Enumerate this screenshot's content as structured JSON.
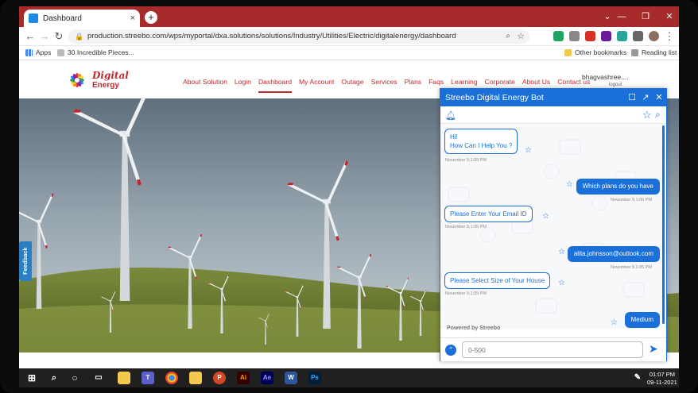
{
  "browser": {
    "tab_title": "Dashboard",
    "tab_close": "×",
    "new_tab": "+",
    "url": "production.streebo.com/wps/myportal/dxa.solutions/solutions/Industry/Utilities/Electric/digitalenergy/dashboard",
    "back": "←",
    "forward": "→",
    "reload": "↻",
    "min": "—",
    "max": "❐",
    "close": "✕",
    "bookmarks": {
      "apps": "Apps",
      "item1": "30 Incredible Pieces...",
      "other": "Other bookmarks",
      "reading": "Reading list"
    }
  },
  "site": {
    "logo_line1": "Digital",
    "logo_line2": "Energy",
    "nav": [
      "About Solution",
      "Login",
      "Dashboard",
      "My Account",
      "Outage",
      "Services",
      "Plans",
      "Faqs",
      "Learning",
      "Corporate",
      "About Us",
      "Contact us"
    ],
    "active_nav": "Dashboard",
    "user": "bhagvashree....",
    "user_sub": "logout",
    "feedback": "Feedback"
  },
  "bot": {
    "title": "Streebo Digital Energy Bot",
    "messages": [
      {
        "from": "bot",
        "lines": [
          "Hi!",
          "How Can I Help You ?"
        ],
        "time": "November 9,1:05 PM"
      },
      {
        "from": "user",
        "text": "Which plans do you have",
        "time": "November 9,1:05 PM"
      },
      {
        "from": "bot",
        "lines": [
          "Please Enter Your Email ID"
        ],
        "time": "November 9,1:05 PM"
      },
      {
        "from": "user",
        "text": "alita.johnsson@outlook.com",
        "time": "November 9,1:05 PM"
      },
      {
        "from": "bot",
        "lines": [
          "Please Select Size of Your House"
        ],
        "time": "November 9,1:05 PM"
      },
      {
        "from": "user",
        "text": "Medium",
        "time": "November 9,1:05 PM"
      }
    ],
    "powered": "Powered by Streebo",
    "input_placeholder": "0-500"
  },
  "taskbar": {
    "time": "01:07 PM",
    "date": "09-11-2021",
    "apps": [
      "Windows",
      "Search",
      "Cortana",
      "Task View",
      "Sticky Notes",
      "Teams",
      "Chrome",
      "File Explorer",
      "PowerPoint",
      "Illustrator",
      "After Effects",
      "Word",
      "Photoshop"
    ]
  },
  "colors": {
    "brand_red": "#c0282d",
    "bot_blue": "#1a6fd8",
    "chrome_tab": "#a72b2b"
  }
}
